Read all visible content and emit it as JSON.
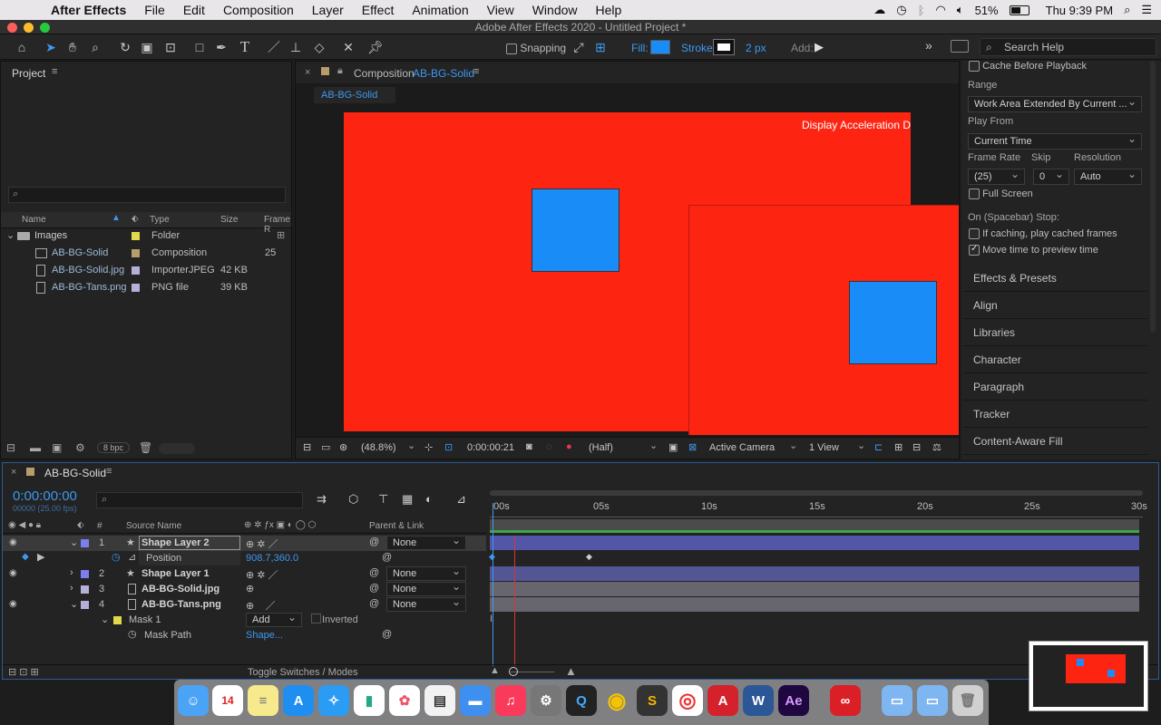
{
  "menubar": {
    "app": "After Effects",
    "items": [
      "File",
      "Edit",
      "Composition",
      "Layer",
      "Effect",
      "Animation",
      "View",
      "Window",
      "Help"
    ],
    "battery": "51%",
    "clock": "Thu 9:39 PM"
  },
  "window_title": "Adobe After Effects 2020 - Untitled Project *",
  "toolbar": {
    "snapping": "Snapping",
    "fill": "Fill:",
    "stroke": "Stroke:",
    "stroke_px": "2 px",
    "add": "Add:",
    "search": "Search Help"
  },
  "project": {
    "title": "Project",
    "search_placeholder": "",
    "columns": [
      "Name",
      "Type",
      "Size",
      "Frame R"
    ],
    "items": [
      {
        "name": "Images",
        "type": "Folder",
        "size": "",
        "fr": ""
      },
      {
        "name": "AB-BG-Solid",
        "type": "Composition",
        "size": "",
        "fr": "25"
      },
      {
        "name": "AB-BG-Solid.jpg",
        "type": "ImporterJPEG",
        "size": "42 KB",
        "fr": ""
      },
      {
        "name": "AB-BG-Tans.png",
        "type": "PNG file",
        "size": "39 KB",
        "fr": ""
      }
    ],
    "bpc": "8 bpc"
  },
  "composition": {
    "tab_prefix": "Composition",
    "tab_name": "AB-BG-Solid",
    "sub_tab": "AB-BG-Solid",
    "overlay": "Display Acceleration D",
    "zoom": "(48.8%)",
    "timecode": "0:00:00:21",
    "res": "(Half)",
    "camera": "Active Camera",
    "view": "1 View"
  },
  "preview": {
    "cache": "Cache Before Playback",
    "range_label": "Range",
    "range": "Work Area Extended By Current ...",
    "play_from_label": "Play From",
    "play_from": "Current Time",
    "fr_label": "Frame Rate",
    "skip_label": "Skip",
    "res_label": "Resolution",
    "fr": "(25)",
    "skip": "0",
    "res": "Auto",
    "full": "Full Screen",
    "stop_label": "On (Spacebar) Stop:",
    "if_caching": "If caching, play cached frames",
    "move_time": "Move time to preview time"
  },
  "panels": [
    "Effects & Presets",
    "Align",
    "Libraries",
    "Character",
    "Paragraph",
    "Tracker",
    "Content-Aware Fill"
  ],
  "timeline": {
    "tab": "AB-BG-Solid",
    "time": "0:00:00:00",
    "fps": "00000 (25.00 fps)",
    "col_source": "Source Name",
    "col_parent": "Parent & Link",
    "ruler": [
      "00s",
      "05s",
      "10s",
      "15s",
      "20s",
      "25s",
      "30s"
    ],
    "layers": [
      {
        "num": "1",
        "name": "Shape Layer 2",
        "parent": "None"
      },
      {
        "num": "2",
        "name": "Shape Layer 1",
        "parent": "None"
      },
      {
        "num": "3",
        "name": "AB-BG-Solid.jpg",
        "parent": "None"
      },
      {
        "num": "4",
        "name": "AB-BG-Tans.png",
        "parent": "None"
      }
    ],
    "position_label": "Position",
    "position_value": "908.7,360.0",
    "mask_label": "Mask 1",
    "mask_mode": "Add",
    "inverted": "Inverted",
    "mask_path": "Mask Path",
    "mask_path_value": "Shape...",
    "toggle": "Toggle Switches / Modes"
  },
  "colors": {
    "accent": "#3d98f0",
    "comp_red": "#fe2412",
    "comp_blue": "#1a8cf7"
  }
}
